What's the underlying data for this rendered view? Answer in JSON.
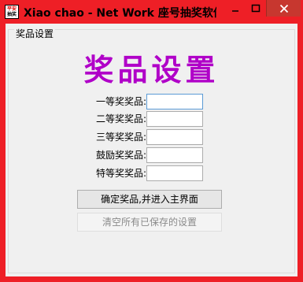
{
  "window": {
    "title": "Xiao chao - Net Work 座号抽奖软件,免费…",
    "icon_top": "平安",
    "icon_bottom": "抽奖",
    "minimize_icon": "minimize-icon",
    "maximize_icon": "maximize-icon",
    "close_icon": "close-icon"
  },
  "group": {
    "caption": "奖品设置",
    "heading": "奖品设置"
  },
  "prizes": [
    {
      "label": "一等奖奖品:",
      "value": ""
    },
    {
      "label": "二等奖奖品:",
      "value": ""
    },
    {
      "label": "三等奖奖品:",
      "value": ""
    },
    {
      "label": "鼓励奖奖品:",
      "value": ""
    },
    {
      "label": "特等奖奖品:",
      "value": ""
    }
  ],
  "buttons": {
    "confirm": "确定奖品,并进入主界面",
    "clear": "清空所有已保存的设置"
  },
  "colors": {
    "frame": "#ee1f26",
    "heading": "#b000c8"
  }
}
